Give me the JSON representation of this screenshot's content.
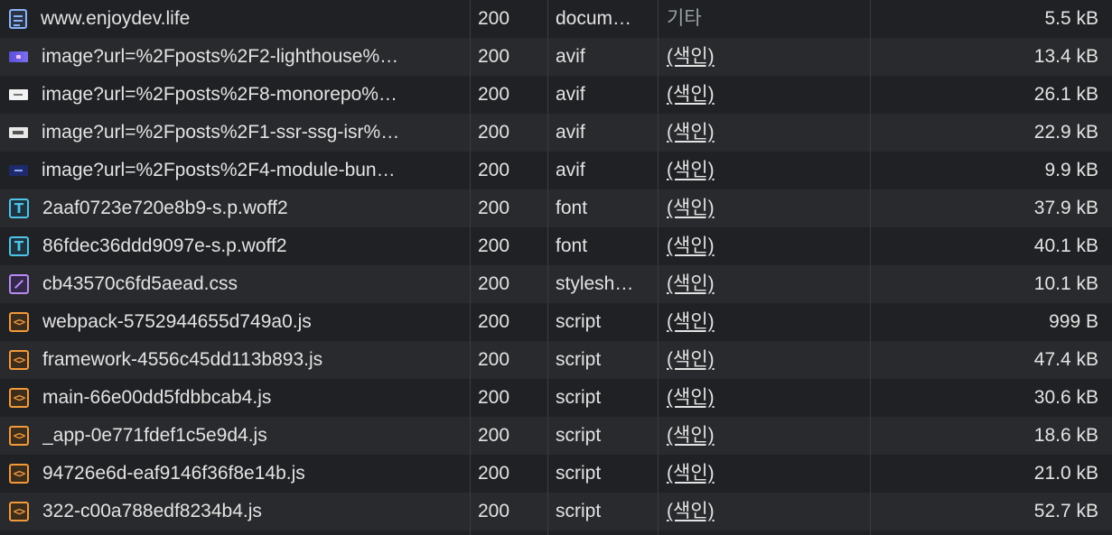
{
  "network": {
    "rows": [
      {
        "name": "www.enjoydev.life",
        "icon": "document-icon",
        "status": "200",
        "type": "docum…",
        "initiator": "기타",
        "initiator_link": false,
        "size": "5.5 kB"
      },
      {
        "name": "image?url=%2Fposts%2F2-lighthouse%…",
        "icon": "image-thumbnail-icon",
        "status": "200",
        "type": "avif",
        "initiator": "(색인)",
        "initiator_link": true,
        "size": "13.4 kB"
      },
      {
        "name": "image?url=%2Fposts%2F8-monorepo%…",
        "icon": "image-thumbnail-icon",
        "status": "200",
        "type": "avif",
        "initiator": "(색인)",
        "initiator_link": true,
        "size": "26.1 kB"
      },
      {
        "name": "image?url=%2Fposts%2F1-ssr-ssg-isr%…",
        "icon": "image-thumbnail-icon",
        "status": "200",
        "type": "avif",
        "initiator": "(색인)",
        "initiator_link": true,
        "size": "22.9 kB"
      },
      {
        "name": "image?url=%2Fposts%2F4-module-bun…",
        "icon": "image-thumbnail-icon",
        "status": "200",
        "type": "avif",
        "initiator": "(색인)",
        "initiator_link": true,
        "size": "9.9 kB"
      },
      {
        "name": "2aaf0723e720e8b9-s.p.woff2",
        "icon": "font-icon",
        "status": "200",
        "type": "font",
        "initiator": "(색인)",
        "initiator_link": true,
        "size": "37.9 kB"
      },
      {
        "name": "86fdec36ddd9097e-s.p.woff2",
        "icon": "font-icon",
        "status": "200",
        "type": "font",
        "initiator": "(색인)",
        "initiator_link": true,
        "size": "40.1 kB"
      },
      {
        "name": "cb43570c6fd5aead.css",
        "icon": "stylesheet-icon",
        "status": "200",
        "type": "stylesh…",
        "initiator": "(색인)",
        "initiator_link": true,
        "size": "10.1 kB"
      },
      {
        "name": "webpack-5752944655d749a0.js",
        "icon": "script-icon",
        "status": "200",
        "type": "script",
        "initiator": "(색인)",
        "initiator_link": true,
        "size": "999 B"
      },
      {
        "name": "framework-4556c45dd113b893.js",
        "icon": "script-icon",
        "status": "200",
        "type": "script",
        "initiator": "(색인)",
        "initiator_link": true,
        "size": "47.4 kB"
      },
      {
        "name": "main-66e00dd5fdbbcab4.js",
        "icon": "script-icon",
        "status": "200",
        "type": "script",
        "initiator": "(색인)",
        "initiator_link": true,
        "size": "30.6 kB"
      },
      {
        "name": "_app-0e771fdef1c5e9d4.js",
        "icon": "script-icon",
        "status": "200",
        "type": "script",
        "initiator": "(색인)",
        "initiator_link": true,
        "size": "18.6 kB"
      },
      {
        "name": "94726e6d-eaf9146f36f8e14b.js",
        "icon": "script-icon",
        "status": "200",
        "type": "script",
        "initiator": "(색인)",
        "initiator_link": true,
        "size": "21.0 kB"
      },
      {
        "name": "322-c00a788edf8234b4.js",
        "icon": "script-icon",
        "status": "200",
        "type": "script",
        "initiator": "(색인)",
        "initiator_link": true,
        "size": "52.7 kB"
      }
    ],
    "icon_glyphs": {
      "font": "T",
      "script": "<>"
    }
  }
}
